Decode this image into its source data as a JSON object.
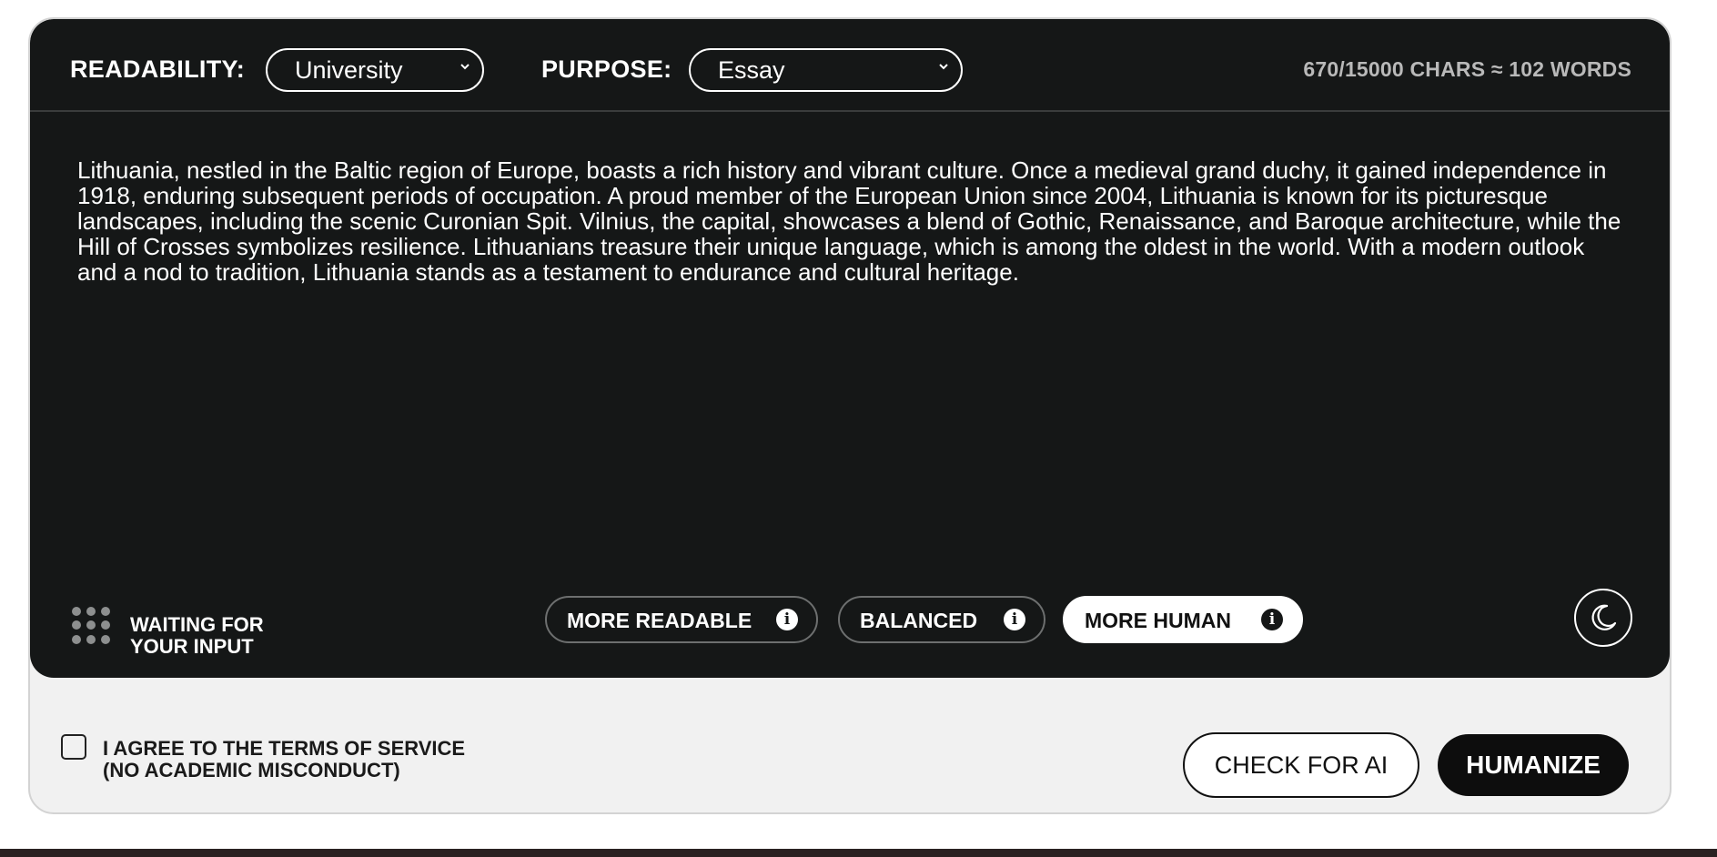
{
  "header": {
    "readability_label": "READABILITY:",
    "readability_value": "University",
    "purpose_label": "PURPOSE:",
    "purpose_value": "Essay",
    "counter": "670/15000 CHARS ≈ 102 WORDS"
  },
  "editor": {
    "text": "Lithuania, nestled in the Baltic region of Europe, boasts a rich history and vibrant culture. Once a medieval grand duchy, it gained independence in 1918, enduring subsequent periods of occupation. A proud member of the European Union since 2004, Lithuania is known for its picturesque landscapes, including the scenic Curonian Spit. Vilnius, the capital, showcases a blend of Gothic, Renaissance, and Baroque architecture, while the Hill of Crosses symbolizes resilience. Lithuanians treasure their unique language, which is among the oldest in the world. With a modern outlook and a nod to tradition, Lithuania stands as a testament to endurance and cultural heritage."
  },
  "status": {
    "line1": "WAITING FOR",
    "line2": "YOUR INPUT"
  },
  "modes": [
    {
      "label": "MORE READABLE",
      "active": false
    },
    {
      "label": "BALANCED",
      "active": false
    },
    {
      "label": "MORE HUMAN",
      "active": true
    }
  ],
  "footer": {
    "agree_line1": "I AGREE TO THE TERMS OF SERVICE",
    "agree_line2": "(NO ACADEMIC MISCONDUCT)",
    "check_label": "CHECK FOR AI",
    "humanize_label": "HUMANIZE"
  },
  "icons": {
    "info": "info-icon",
    "theme": "moon-icon",
    "status": "dots-grid-icon",
    "select": "chevron-down-icon"
  }
}
